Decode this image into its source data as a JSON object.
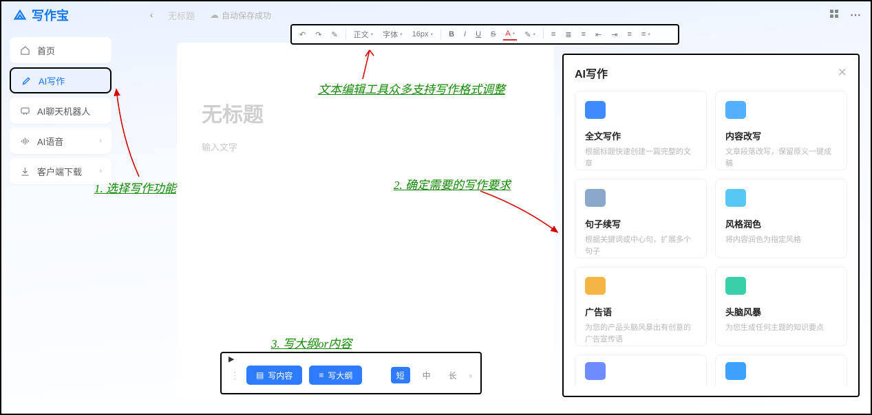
{
  "app": {
    "name": "写作宝"
  },
  "header": {
    "breadcrumb": "无标题",
    "autosave": "自动保存成功"
  },
  "sidebar": {
    "items": [
      {
        "label": "首页"
      },
      {
        "label": "AI写作"
      },
      {
        "label": "AI聊天机器人"
      },
      {
        "label": "AI语音"
      },
      {
        "label": "客户端下载"
      }
    ]
  },
  "toolbar": {
    "text_label": "正文",
    "font_label": "字体",
    "fontsize_label": "16px"
  },
  "editor": {
    "title_placeholder": "无标题",
    "body_placeholder": "输入文字"
  },
  "bottombar": {
    "write_content": "写内容",
    "write_outline": "写大纲",
    "len_short": "短",
    "len_mid": "中",
    "len_long": "长"
  },
  "ai_panel": {
    "title": "AI写作",
    "cards": [
      {
        "name": "全文写作",
        "desc": "根据标题快速创建一篇完整的文章",
        "col": "#3d8bff"
      },
      {
        "name": "内容改写",
        "desc": "文章段落改写，保留原义一键成稿",
        "col": "#52b0ff"
      },
      {
        "name": "句子续写",
        "desc": "根据关键词或中心句，扩展多个句子",
        "col": "#8aa8c9"
      },
      {
        "name": "风格润色",
        "desc": "将内容润色为指定风格",
        "col": "#57c8f2"
      },
      {
        "name": "广告语",
        "desc": "为您的产品头脑风暴出有创意的广告宣传语",
        "col": "#f5b544"
      },
      {
        "name": "头脑风暴",
        "desc": "为您生成任何主题的知识要点",
        "col": "#39d0a9"
      },
      {
        "name": "",
        "desc": "",
        "col": "#6f8cff"
      },
      {
        "name": "",
        "desc": "",
        "col": "#3da2ff"
      }
    ]
  },
  "annotations": {
    "a1": "1. 选择写作功能",
    "a2": "2. 确定需要的写作要求",
    "a3": "3. 写大纲or内容",
    "a_toolbar": "文本编辑工具众多支持写作格式调整"
  }
}
